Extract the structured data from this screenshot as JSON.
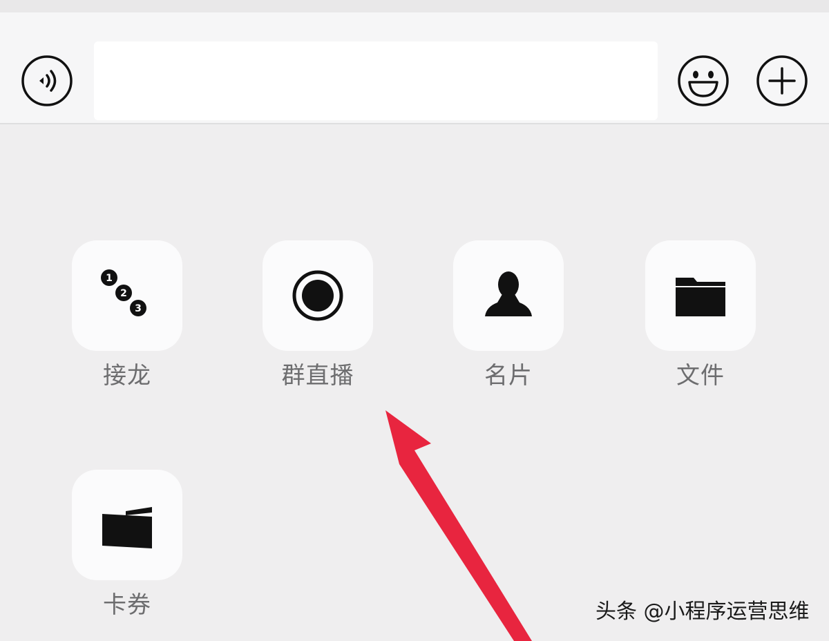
{
  "input_bar": {
    "voice_icon": "voice-wave-icon",
    "emoji_icon": "smiley-face-icon",
    "plus_icon": "plus-icon",
    "message_value": ""
  },
  "panel": {
    "items": [
      {
        "label": "接龙",
        "icon": "numbered-dots-icon"
      },
      {
        "label": "群直播",
        "icon": "live-record-icon"
      },
      {
        "label": "名片",
        "icon": "person-silhouette-icon"
      },
      {
        "label": "文件",
        "icon": "folder-icon"
      },
      {
        "label": "卡券",
        "icon": "card-wallet-icon"
      }
    ]
  },
  "annotation": {
    "arrow_color": "#e8253f"
  },
  "watermark": {
    "text": "头条 @小程序运营思维"
  },
  "colors": {
    "background": "#efeeef",
    "tile": "#fbfbfc",
    "label": "#6d6d6f",
    "icon": "#111111"
  }
}
